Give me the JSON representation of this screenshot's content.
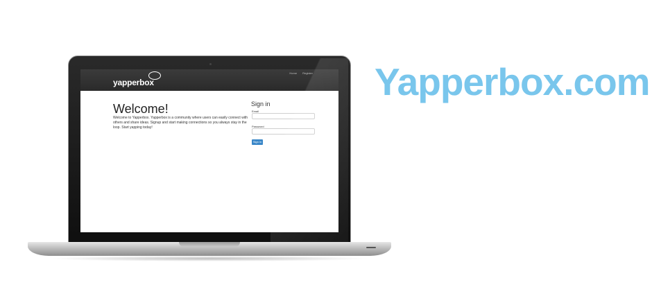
{
  "headline": "Yapperbox.com",
  "site": {
    "brand": "yapperbox",
    "nav": {
      "home": "Home",
      "register": "Register"
    },
    "welcome_title": "Welcome!",
    "welcome_text": "Welcome to Yapperbox. Yapperbox is a community where users can easily connect with others and share ideas. Signup and start making connections so you always stay in the loop. Start yapping today!",
    "signin_title": "Sign in",
    "email_label": "Email",
    "password_label": "Password",
    "signin_button": "Sign in"
  },
  "colors": {
    "headline": "#79c6ec",
    "button": "#3a87c8",
    "navbar": "#2f2f2f"
  }
}
